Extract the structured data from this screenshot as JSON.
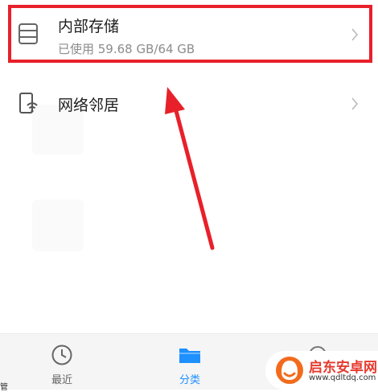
{
  "list": {
    "storage": {
      "title": "内部存储",
      "usage": "已使用 59.68 GB/64 GB"
    },
    "network": {
      "title": "网络邻居"
    }
  },
  "bottom_nav": {
    "recent_label": "最近",
    "category_label": "分类",
    "active_color": "#1e90ff"
  },
  "watermark": {
    "name": "启东安卓网",
    "url": "www.qdltdq.com"
  },
  "colors": {
    "highlight": "#e8202a",
    "accent": "#1e90ff"
  },
  "icons": [
    "storage-icon",
    "network-neighbor-icon",
    "chevron-right-icon",
    "clock-icon",
    "folder-icon"
  ]
}
